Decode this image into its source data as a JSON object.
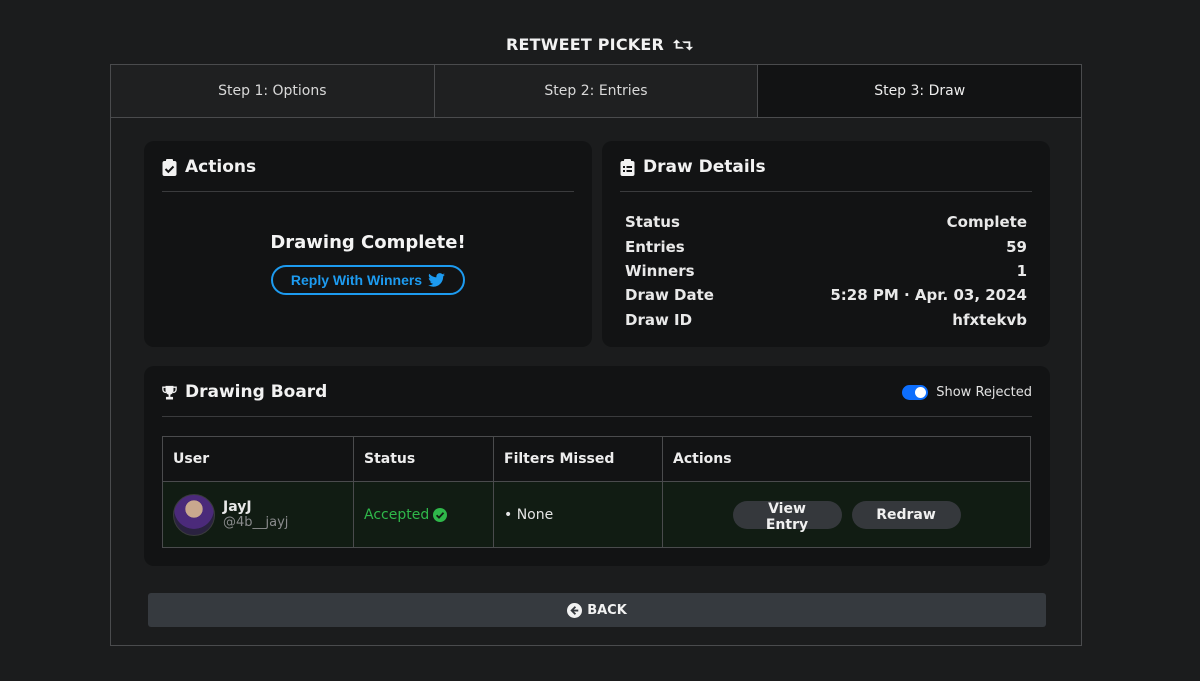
{
  "app": {
    "title": "RETWEET PICKER"
  },
  "steps": [
    {
      "label": "Step 1: Options"
    },
    {
      "label": "Step 2: Entries"
    },
    {
      "label": "Step 3: Draw"
    }
  ],
  "actions": {
    "heading": "Actions",
    "complete_text": "Drawing Complete!",
    "reply_label": "Reply With Winners"
  },
  "details": {
    "heading": "Draw Details",
    "rows": [
      {
        "label": "Status",
        "value": "Complete"
      },
      {
        "label": "Entries",
        "value": "59"
      },
      {
        "label": "Winners",
        "value": "1"
      },
      {
        "label": "Draw Date",
        "value": "5:28 PM · Apr. 03, 2024"
      },
      {
        "label": "Draw ID",
        "value": "hfxtekvb"
      }
    ]
  },
  "board": {
    "heading": "Drawing Board",
    "toggle_label": "Show Rejected",
    "columns": [
      "User",
      "Status",
      "Filters Missed",
      "Actions"
    ],
    "rows": [
      {
        "name": "JayJ",
        "handle": "@4b__jayj",
        "status": "Accepted",
        "filters": "• None",
        "view_label": "View Entry",
        "redraw_label": "Redraw"
      }
    ]
  },
  "back_label": "BACK",
  "colors": {
    "accent_blue": "#1d9bf0",
    "toggle_blue": "#0d6efd",
    "accepted_green": "#2fb84a",
    "row_bg": "#111c13"
  }
}
